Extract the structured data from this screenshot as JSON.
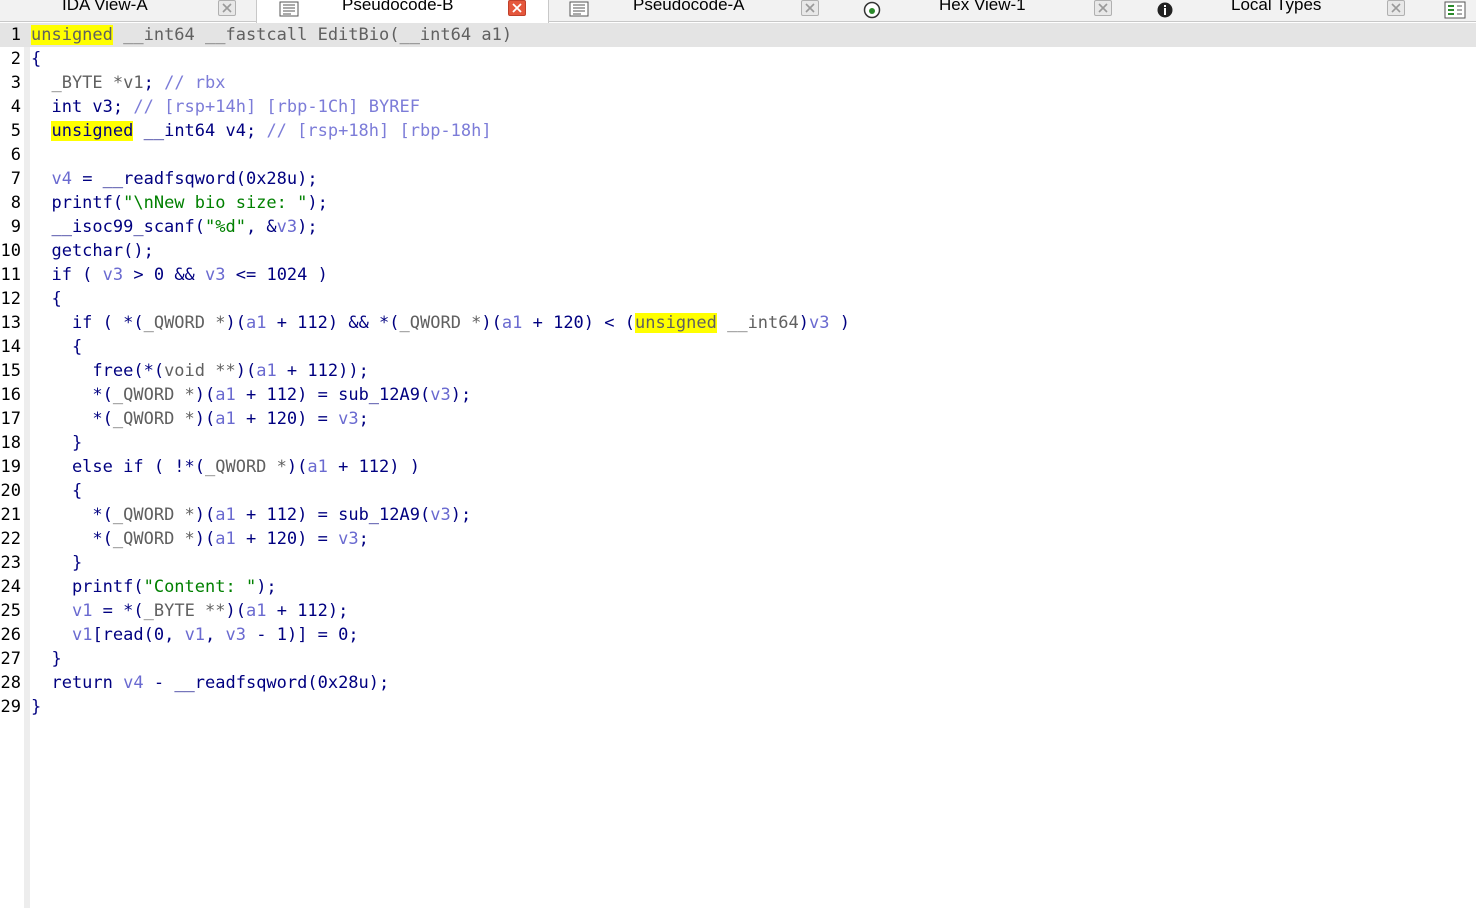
{
  "tabs": [
    {
      "label": "IDA View-A",
      "icon": "graph-icon",
      "active": false
    },
    {
      "label": "Pseudocode-B",
      "icon": "pseudocode-icon",
      "active": true
    },
    {
      "label": "Pseudocode-A",
      "icon": "pseudocode-icon",
      "active": false
    },
    {
      "label": "Hex View-1",
      "icon": "hex-view-icon",
      "active": false
    },
    {
      "label": "Local Types",
      "icon": "local-types-icon",
      "active": false
    }
  ],
  "colors": {
    "highlight": "#ffff00",
    "current_line": "#e4e4e4",
    "active_close": "#e5573c"
  },
  "code": {
    "line_numbers": [
      "1",
      "2",
      "3",
      "4",
      "5",
      "6",
      "7",
      "8",
      "9",
      "10",
      "11",
      "12",
      "13",
      "14",
      "15",
      "16",
      "17",
      "18",
      "19",
      "20",
      "21",
      "22",
      "23",
      "24",
      "25",
      "26",
      "27",
      "28",
      "29"
    ],
    "lines": [
      [
        {
          "t": "unsigned",
          "c": "g",
          "h": true
        },
        {
          "t": " __int64 __fastcall EditBio(__int64 a1)",
          "c": "g"
        }
      ],
      [
        {
          "t": "{",
          "c": "n"
        }
      ],
      [
        {
          "t": "  _BYTE *",
          "c": "g"
        },
        {
          "t": "v1",
          "c": "g"
        },
        {
          "t": "; ",
          "c": "n"
        },
        {
          "t": "// rbx",
          "c": "cm"
        }
      ],
      [
        {
          "t": "  int v3; ",
          "c": "n"
        },
        {
          "t": "// [rsp+14h] [rbp-1Ch] BYREF",
          "c": "cm"
        }
      ],
      [
        {
          "t": "  ",
          "c": "n"
        },
        {
          "t": "unsigned",
          "c": "n",
          "h": true
        },
        {
          "t": " __int64 v4; ",
          "c": "n"
        },
        {
          "t": "// [rsp+18h] [rbp-18h]",
          "c": "cm"
        }
      ],
      [],
      [
        {
          "t": "  ",
          "c": "n"
        },
        {
          "t": "v4",
          "c": "v"
        },
        {
          "t": " = __readfsqword(0x28u);",
          "c": "n"
        }
      ],
      [
        {
          "t": "  printf(",
          "c": "n"
        },
        {
          "t": "\"\\nNew bio size: \"",
          "c": "s"
        },
        {
          "t": ");",
          "c": "n"
        }
      ],
      [
        {
          "t": "  __isoc99_scanf(",
          "c": "n"
        },
        {
          "t": "\"%d\"",
          "c": "s"
        },
        {
          "t": ", &",
          "c": "n"
        },
        {
          "t": "v3",
          "c": "v"
        },
        {
          "t": ");",
          "c": "n"
        }
      ],
      [
        {
          "t": "  getchar();",
          "c": "n"
        }
      ],
      [
        {
          "t": "  if ( ",
          "c": "n"
        },
        {
          "t": "v3",
          "c": "v"
        },
        {
          "t": " > 0 && ",
          "c": "n"
        },
        {
          "t": "v3",
          "c": "v"
        },
        {
          "t": " <= 1024 )",
          "c": "n"
        }
      ],
      [
        {
          "t": "  {",
          "c": "n"
        }
      ],
      [
        {
          "t": "    if ( *(",
          "c": "n"
        },
        {
          "t": "_QWORD *",
          "c": "g"
        },
        {
          "t": ")(",
          "c": "n"
        },
        {
          "t": "a1",
          "c": "v"
        },
        {
          "t": " + 112) && *(",
          "c": "n"
        },
        {
          "t": "_QWORD *",
          "c": "g"
        },
        {
          "t": ")(",
          "c": "n"
        },
        {
          "t": "a1",
          "c": "v"
        },
        {
          "t": " + 120) < (",
          "c": "n"
        },
        {
          "t": "unsigned",
          "c": "g",
          "h": true
        },
        {
          "t": " __int64",
          "c": "g"
        },
        {
          "t": ")",
          "c": "n"
        },
        {
          "t": "v3",
          "c": "v"
        },
        {
          "t": " )",
          "c": "n"
        }
      ],
      [
        {
          "t": "    {",
          "c": "n"
        }
      ],
      [
        {
          "t": "      free(*(",
          "c": "n"
        },
        {
          "t": "void **",
          "c": "g"
        },
        {
          "t": ")(",
          "c": "n"
        },
        {
          "t": "a1",
          "c": "v"
        },
        {
          "t": " + 112));",
          "c": "n"
        }
      ],
      [
        {
          "t": "      *(",
          "c": "n"
        },
        {
          "t": "_QWORD *",
          "c": "g"
        },
        {
          "t": ")(",
          "c": "n"
        },
        {
          "t": "a1",
          "c": "v"
        },
        {
          "t": " + 112) = sub_12A9(",
          "c": "n"
        },
        {
          "t": "v3",
          "c": "v"
        },
        {
          "t": ");",
          "c": "n"
        }
      ],
      [
        {
          "t": "      *(",
          "c": "n"
        },
        {
          "t": "_QWORD *",
          "c": "g"
        },
        {
          "t": ")(",
          "c": "n"
        },
        {
          "t": "a1",
          "c": "v"
        },
        {
          "t": " + 120) = ",
          "c": "n"
        },
        {
          "t": "v3",
          "c": "v"
        },
        {
          "t": ";",
          "c": "n"
        }
      ],
      [
        {
          "t": "    }",
          "c": "n"
        }
      ],
      [
        {
          "t": "    else if ( !*(",
          "c": "n"
        },
        {
          "t": "_QWORD *",
          "c": "g"
        },
        {
          "t": ")(",
          "c": "n"
        },
        {
          "t": "a1",
          "c": "v"
        },
        {
          "t": " + 112) )",
          "c": "n"
        }
      ],
      [
        {
          "t": "    {",
          "c": "n"
        }
      ],
      [
        {
          "t": "      *(",
          "c": "n"
        },
        {
          "t": "_QWORD *",
          "c": "g"
        },
        {
          "t": ")(",
          "c": "n"
        },
        {
          "t": "a1",
          "c": "v"
        },
        {
          "t": " + 112) = sub_12A9(",
          "c": "n"
        },
        {
          "t": "v3",
          "c": "v"
        },
        {
          "t": ");",
          "c": "n"
        }
      ],
      [
        {
          "t": "      *(",
          "c": "n"
        },
        {
          "t": "_QWORD *",
          "c": "g"
        },
        {
          "t": ")(",
          "c": "n"
        },
        {
          "t": "a1",
          "c": "v"
        },
        {
          "t": " + 120) = ",
          "c": "n"
        },
        {
          "t": "v3",
          "c": "v"
        },
        {
          "t": ";",
          "c": "n"
        }
      ],
      [
        {
          "t": "    }",
          "c": "n"
        }
      ],
      [
        {
          "t": "    printf(",
          "c": "n"
        },
        {
          "t": "\"Content: \"",
          "c": "s"
        },
        {
          "t": ");",
          "c": "n"
        }
      ],
      [
        {
          "t": "    ",
          "c": "n"
        },
        {
          "t": "v1",
          "c": "v"
        },
        {
          "t": " = *(",
          "c": "n"
        },
        {
          "t": "_BYTE **",
          "c": "g"
        },
        {
          "t": ")(",
          "c": "n"
        },
        {
          "t": "a1",
          "c": "v"
        },
        {
          "t": " + 112);",
          "c": "n"
        }
      ],
      [
        {
          "t": "    ",
          "c": "n"
        },
        {
          "t": "v1",
          "c": "v"
        },
        {
          "t": "[read(0, ",
          "c": "n"
        },
        {
          "t": "v1",
          "c": "v"
        },
        {
          "t": ", ",
          "c": "n"
        },
        {
          "t": "v3",
          "c": "v"
        },
        {
          "t": " - 1)] = 0;",
          "c": "n"
        }
      ],
      [
        {
          "t": "  }",
          "c": "n"
        }
      ],
      [
        {
          "t": "  return ",
          "c": "n"
        },
        {
          "t": "v4",
          "c": "v"
        },
        {
          "t": " - __readfsqword(0x28u);",
          "c": "n"
        }
      ],
      [
        {
          "t": "}",
          "c": "n"
        }
      ]
    ]
  }
}
